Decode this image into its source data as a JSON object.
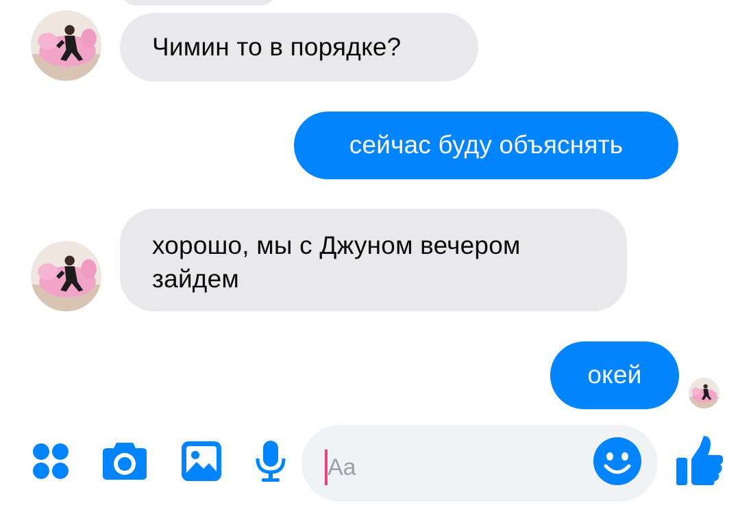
{
  "conversation": {
    "messages": [
      {
        "direction": "incoming",
        "text": "Чимин то в порядке?"
      },
      {
        "direction": "outgoing",
        "text": "сейчас буду объяснять"
      },
      {
        "direction": "incoming",
        "text": "хорошо, мы с Джуном вечером зайдем"
      },
      {
        "direction": "outgoing",
        "text": "окей"
      }
    ]
  },
  "composer": {
    "placeholder": "Aa",
    "icons": [
      "more-icon",
      "camera-icon",
      "gallery-icon",
      "microphone-icon",
      "emoji-icon",
      "like-icon"
    ]
  },
  "colors": {
    "accent": "#0084ff",
    "incoming_bubble": "#e9e9eb",
    "input_background": "#f1f2f6",
    "caret": "#e8457a"
  }
}
